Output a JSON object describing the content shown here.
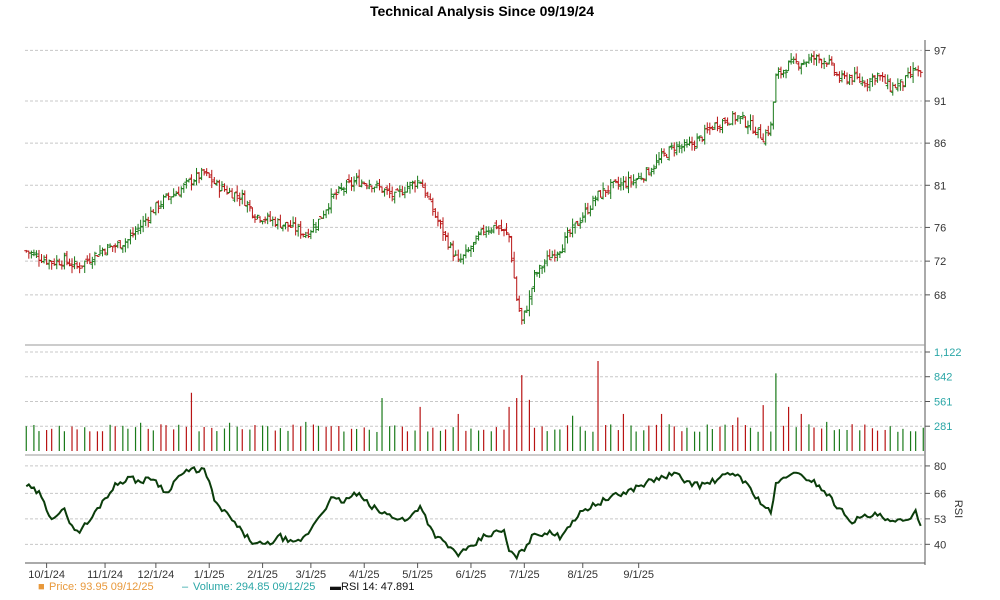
{
  "chart_data": {
    "type": "line",
    "title": "Technical Analysis Since 09/19/24",
    "x_ticks": [
      "10/1/24",
      "11/1/24",
      "12/1/24",
      "1/1/25",
      "2/1/25",
      "3/1/25",
      "4/1/25",
      "5/1/25",
      "6/1/25",
      "7/1/25",
      "8/1/25",
      "9/1/25"
    ],
    "grid": true,
    "panels": {
      "price": {
        "type": "ohlc",
        "ylim": [
          63,
          98
        ],
        "y_ticks": [
          68,
          72,
          76,
          81,
          86,
          91,
          97
        ],
        "up_color": "#1a7a1a",
        "down_color": "#b81414",
        "closes": [
          [
            0,
            73.2
          ],
          [
            5,
            72.5
          ],
          [
            10,
            71.9
          ],
          [
            15,
            72.1
          ],
          [
            20,
            71.3
          ],
          [
            25,
            72.3
          ],
          [
            30,
            73.4
          ],
          [
            35,
            73.8
          ],
          [
            40,
            74.5
          ],
          [
            45,
            76.2
          ],
          [
            50,
            78.1
          ],
          [
            55,
            79.5
          ],
          [
            60,
            80.3
          ],
          [
            65,
            81.6
          ],
          [
            70,
            82.4
          ],
          [
            75,
            81.0
          ],
          [
            80,
            80.2
          ],
          [
            85,
            79.6
          ],
          [
            90,
            77.5
          ],
          [
            95,
            77.0
          ],
          [
            100,
            76.5
          ],
          [
            105,
            76.0
          ],
          [
            110,
            75.2
          ],
          [
            115,
            76.8
          ],
          [
            120,
            79.4
          ],
          [
            125,
            80.7
          ],
          [
            130,
            81.5
          ],
          [
            135,
            81.3
          ],
          [
            140,
            80.5
          ],
          [
            145,
            79.6
          ],
          [
            150,
            80.9
          ],
          [
            155,
            81.6
          ],
          [
            160,
            78.0
          ],
          [
            165,
            74.8
          ],
          [
            170,
            71.8
          ],
          [
            175,
            73.5
          ],
          [
            180,
            75.7
          ],
          [
            185,
            76.2
          ],
          [
            188,
            75.4
          ],
          [
            190,
            74.9
          ],
          [
            193,
            67.5
          ],
          [
            195,
            64.8
          ],
          [
            198,
            67.5
          ],
          [
            200,
            70.2
          ],
          [
            205,
            72.2
          ],
          [
            210,
            73.6
          ],
          [
            215,
            75.7
          ],
          [
            220,
            77.8
          ],
          [
            225,
            79.8
          ],
          [
            230,
            80.8
          ],
          [
            235,
            81.2
          ],
          [
            240,
            81.7
          ],
          [
            245,
            82.7
          ],
          [
            250,
            84.3
          ],
          [
            255,
            85.6
          ],
          [
            260,
            85.5
          ],
          [
            265,
            86.5
          ],
          [
            270,
            88.0
          ],
          [
            275,
            88.7
          ],
          [
            280,
            89.1
          ],
          [
            285,
            88.1
          ],
          [
            290,
            86.7
          ],
          [
            293,
            88.0
          ],
          [
            295,
            93.8
          ],
          [
            300,
            95.3
          ],
          [
            305,
            95.6
          ],
          [
            310,
            96.1
          ],
          [
            315,
            95.8
          ],
          [
            320,
            93.6
          ],
          [
            325,
            93.8
          ],
          [
            330,
            93.2
          ],
          [
            335,
            94.1
          ],
          [
            340,
            92.6
          ],
          [
            345,
            93.1
          ],
          [
            350,
            94.8
          ],
          [
            352,
            93.95
          ]
        ]
      },
      "volume": {
        "type": "bar",
        "ylim": [
          0,
          1122
        ],
        "y_ticks": [
          281,
          561,
          842,
          1122
        ],
        "last_value": "294.85",
        "spikes": [
          [
            35,
            280
          ],
          [
            45,
            320
          ],
          [
            65,
            660
          ],
          [
            80,
            320
          ],
          [
            110,
            330
          ],
          [
            140,
            600
          ],
          [
            155,
            500
          ],
          [
            170,
            420
          ],
          [
            177,
            440
          ],
          [
            182,
            330
          ],
          [
            190,
            500
          ],
          [
            193,
            600
          ],
          [
            195,
            860
          ],
          [
            198,
            580
          ],
          [
            215,
            400
          ],
          [
            225,
            1020
          ],
          [
            229,
            1060
          ],
          [
            235,
            420
          ],
          [
            250,
            420
          ],
          [
            268,
            300
          ],
          [
            280,
            380
          ],
          [
            290,
            520
          ],
          [
            295,
            880
          ],
          [
            300,
            500
          ],
          [
            305,
            420
          ],
          [
            315,
            330
          ],
          [
            330,
            300
          ]
        ],
        "base": 260
      },
      "rsi": {
        "type": "line",
        "label": "RSI",
        "ylim": [
          32,
          82
        ],
        "y_ticks": [
          40,
          53,
          66,
          80
        ],
        "color": "#0b3d0b",
        "values": [
          [
            0,
            70
          ],
          [
            5,
            66
          ],
          [
            8,
            58
          ],
          [
            10,
            54
          ],
          [
            15,
            57
          ],
          [
            18,
            50
          ],
          [
            20,
            46
          ],
          [
            25,
            52
          ],
          [
            30,
            62
          ],
          [
            35,
            70
          ],
          [
            40,
            74
          ],
          [
            45,
            72
          ],
          [
            50,
            74
          ],
          [
            55,
            66
          ],
          [
            60,
            75
          ],
          [
            62,
            76
          ],
          [
            65,
            78
          ],
          [
            70,
            78
          ],
          [
            75,
            60
          ],
          [
            80,
            54
          ],
          [
            85,
            46
          ],
          [
            90,
            40
          ],
          [
            95,
            40
          ],
          [
            100,
            44
          ],
          [
            105,
            40
          ],
          [
            110,
            44
          ],
          [
            115,
            54
          ],
          [
            120,
            63
          ],
          [
            125,
            62
          ],
          [
            130,
            66
          ],
          [
            135,
            60
          ],
          [
            140,
            56
          ],
          [
            145,
            54
          ],
          [
            150,
            52
          ],
          [
            155,
            60
          ],
          [
            160,
            46
          ],
          [
            165,
            40
          ],
          [
            170,
            35
          ],
          [
            175,
            38
          ],
          [
            180,
            44
          ],
          [
            185,
            46
          ],
          [
            188,
            47
          ],
          [
            190,
            36
          ],
          [
            193,
            34
          ],
          [
            195,
            36
          ],
          [
            198,
            42
          ],
          [
            200,
            45
          ],
          [
            205,
            46
          ],
          [
            210,
            44
          ],
          [
            215,
            52
          ],
          [
            220,
            58
          ],
          [
            225,
            61
          ],
          [
            230,
            64
          ],
          [
            235,
            66
          ],
          [
            240,
            69
          ],
          [
            245,
            72
          ],
          [
            250,
            74
          ],
          [
            255,
            76
          ],
          [
            260,
            72
          ],
          [
            265,
            70
          ],
          [
            270,
            72
          ],
          [
            275,
            75
          ],
          [
            280,
            76
          ],
          [
            285,
            68
          ],
          [
            290,
            60
          ],
          [
            293,
            56
          ],
          [
            295,
            70
          ],
          [
            300,
            76
          ],
          [
            305,
            75
          ],
          [
            310,
            72
          ],
          [
            315,
            66
          ],
          [
            320,
            58
          ],
          [
            325,
            52
          ],
          [
            330,
            54
          ],
          [
            335,
            55
          ],
          [
            340,
            51
          ],
          [
            345,
            52
          ],
          [
            350,
            56
          ],
          [
            352,
            47.891
          ]
        ]
      }
    },
    "legend": [
      {
        "marker": "■",
        "label": "Price: 93.95  09/12/25",
        "color": "#e8983a"
      },
      {
        "marker": "–",
        "label": "Volume: 294.85  09/12/25",
        "color": "#2aa6a6"
      },
      {
        "marker": "▬",
        "label": "RSI 14: 47.891",
        "color": "#111111"
      }
    ]
  }
}
